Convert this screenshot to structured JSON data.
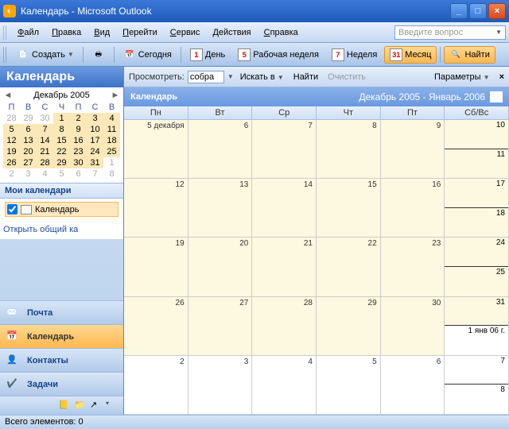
{
  "window": {
    "title": "Календарь - Microsoft Outlook"
  },
  "menu": {
    "file": "Файл",
    "edit": "Правка",
    "view": "Вид",
    "go": "Перейти",
    "tools": "Сервис",
    "actions": "Действия",
    "help": "Справка",
    "search_placeholder": "Введите вопрос"
  },
  "toolbar": {
    "create": "Создать",
    "today": "Сегодня",
    "day": "День",
    "workweek": "Рабочая неделя",
    "week": "Неделя",
    "month": "Месяц",
    "find": "Найти",
    "ico_day": "1",
    "ico_ww": "5",
    "ico_week": "7",
    "ico_month": "31"
  },
  "nav": {
    "title": "Календарь",
    "dp_month": "Декабрь 2005",
    "dow": [
      "П",
      "В",
      "С",
      "Ч",
      "П",
      "С",
      "В"
    ],
    "days": [
      [
        28,
        "o"
      ],
      [
        29,
        "o"
      ],
      [
        30,
        "o"
      ],
      [
        1,
        "c"
      ],
      [
        2,
        "c"
      ],
      [
        3,
        "c"
      ],
      [
        4,
        "c"
      ],
      [
        5,
        "c"
      ],
      [
        6,
        "c"
      ],
      [
        7,
        "c"
      ],
      [
        8,
        "c"
      ],
      [
        9,
        "c"
      ],
      [
        10,
        "c"
      ],
      [
        11,
        "c"
      ],
      [
        12,
        "c"
      ],
      [
        13,
        "c"
      ],
      [
        14,
        "c"
      ],
      [
        15,
        "c"
      ],
      [
        16,
        "c"
      ],
      [
        17,
        "c"
      ],
      [
        18,
        "c"
      ],
      [
        19,
        "c"
      ],
      [
        20,
        "c"
      ],
      [
        21,
        "c"
      ],
      [
        22,
        "c"
      ],
      [
        23,
        "c"
      ],
      [
        24,
        "c"
      ],
      [
        25,
        "c"
      ],
      [
        26,
        "c"
      ],
      [
        27,
        "c"
      ],
      [
        28,
        "c"
      ],
      [
        29,
        "c"
      ],
      [
        30,
        "c"
      ],
      [
        31,
        "c"
      ],
      [
        1,
        "o"
      ],
      [
        2,
        "o"
      ],
      [
        3,
        "o"
      ],
      [
        4,
        "o"
      ],
      [
        5,
        "o"
      ],
      [
        6,
        "o"
      ],
      [
        7,
        "o"
      ],
      [
        8,
        "o"
      ]
    ],
    "mycal_h": "Мои календари",
    "mycal_item": "Календарь",
    "share_link": "Открыть общий ка",
    "mail": "Почта",
    "calendar": "Календарь",
    "contacts": "Контакты",
    "tasks": "Задачи"
  },
  "view": {
    "browse": "Просмотреть:",
    "input_val": "собра",
    "search_in": "Искать в",
    "find": "Найти",
    "clear": "Очистить",
    "params": "Параметры"
  },
  "calhead": {
    "title": "Календарь",
    "range": "Декабрь 2005 - Январь 2006"
  },
  "dow": {
    "mon": "Пн",
    "tue": "Вт",
    "wed": "Ср",
    "thu": "Чт",
    "fri": "Пт",
    "weekend": "Сб/Вс"
  },
  "month": {
    "rows": [
      {
        "cells": [
          "5 декабря",
          "6",
          "7",
          "8",
          "9"
        ],
        "sat": "10",
        "sun": "11"
      },
      {
        "cells": [
          "12",
          "13",
          "14",
          "15",
          "16"
        ],
        "sat": "17",
        "sun": "18"
      },
      {
        "cells": [
          "19",
          "20",
          "21",
          "22",
          "23"
        ],
        "sat": "24",
        "sun": "25"
      },
      {
        "cells": [
          "26",
          "27",
          "28",
          "29",
          "30"
        ],
        "sat": "31",
        "sun": "1 янв 06 г.",
        "sun_other": true
      },
      {
        "cells": [
          "2",
          "3",
          "4",
          "5",
          "6"
        ],
        "other": true,
        "sat": "7",
        "sun": "8",
        "sat_other": true,
        "sun_other": true
      }
    ]
  },
  "status": {
    "text": "Всего элементов: 0"
  }
}
